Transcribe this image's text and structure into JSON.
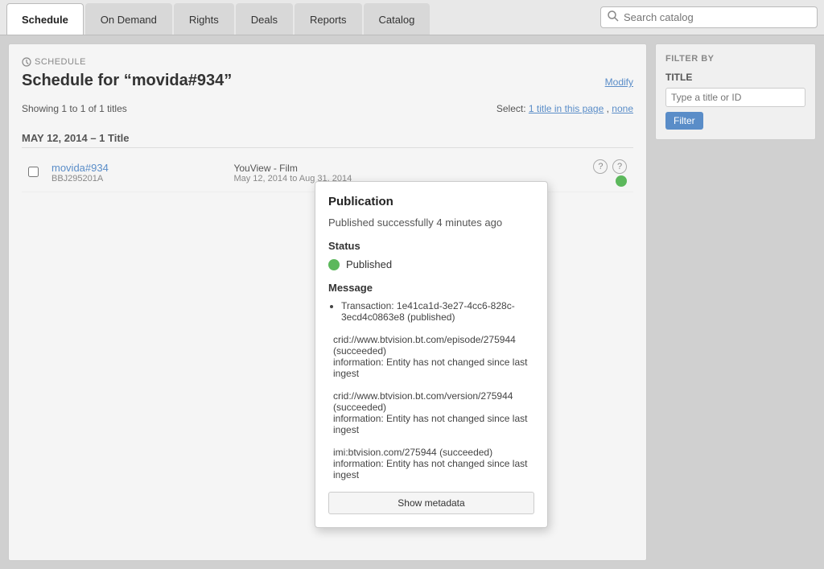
{
  "nav": {
    "tabs": [
      {
        "label": "Schedule",
        "active": true
      },
      {
        "label": "On Demand",
        "active": false
      },
      {
        "label": "Rights",
        "active": false
      },
      {
        "label": "Deals",
        "active": false
      },
      {
        "label": "Reports",
        "active": false
      },
      {
        "label": "Catalog",
        "active": false
      }
    ],
    "search_placeholder": "Search catalog"
  },
  "schedule_label": "SCHEDULE",
  "page_title": "Schedule for “movida#934”",
  "modify_label": "Modify",
  "showing_text": "Showing 1 to 1 of 1 titles",
  "select_label": "Select:",
  "select_this_page": "1 title in this page",
  "select_none": "none",
  "date_group": {
    "date": "MAY 12, 2014",
    "count": "1 Title"
  },
  "schedule_item": {
    "title_link": "movida#934",
    "sub_id": "BBJ295201A",
    "service": "YouView - Film",
    "date_range": "May 12, 2014 to Aug 31, 2014"
  },
  "filter": {
    "by_label": "FILTER BY",
    "title_label": "TITLE",
    "input_placeholder": "Type a title or ID",
    "filter_btn": "Filter"
  },
  "popup": {
    "title": "Publication",
    "published_msg": "Published successfully 4 minutes ago",
    "status_section": "Status",
    "status_text": "Published",
    "message_section": "Message",
    "messages": [
      {
        "type": "bullet",
        "text": "Transaction: 1e41ca1d-3e27-4cc6-828c-3ecd4c0863e8 (published)"
      },
      {
        "type": "block",
        "lines": [
          "crid://www.btvision.bt.com/episode/275944 (succeeded)",
          "information: Entity has not changed since last ingest"
        ]
      },
      {
        "type": "block",
        "lines": [
          "crid://www.btvision.bt.com/version/275944 (succeeded)",
          "information: Entity has not changed since last ingest"
        ]
      },
      {
        "type": "block",
        "lines": [
          "imi:btvision.com/275944 (succeeded)",
          "information: Entity has not changed since last ingest"
        ]
      }
    ],
    "show_metadata_btn": "Show metadata"
  }
}
